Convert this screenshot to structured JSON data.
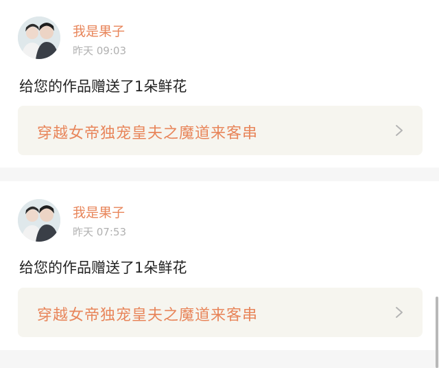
{
  "feed": {
    "items": [
      {
        "username": "我是果子",
        "timestamp": "昨天 09:03",
        "message": "给您的作品赠送了1朵鲜花",
        "work_title": "穿越女帝独宠皇夫之魔道来客串",
        "avatar_icon": "avatar-two-people",
        "link_icon": "chevron-right-icon"
      },
      {
        "username": "我是果子",
        "timestamp": "昨天 07:53",
        "message": "给您的作品赠送了1朵鲜花",
        "work_title": "穿越女帝独宠皇夫之魔道来客串",
        "avatar_icon": "avatar-two-people",
        "link_icon": "chevron-right-icon"
      }
    ]
  },
  "colors": {
    "accent": "#e8855a",
    "timestamp": "#b0b0b0",
    "link_background": "#f6f5ef",
    "page_background": "#f6f6f6"
  }
}
